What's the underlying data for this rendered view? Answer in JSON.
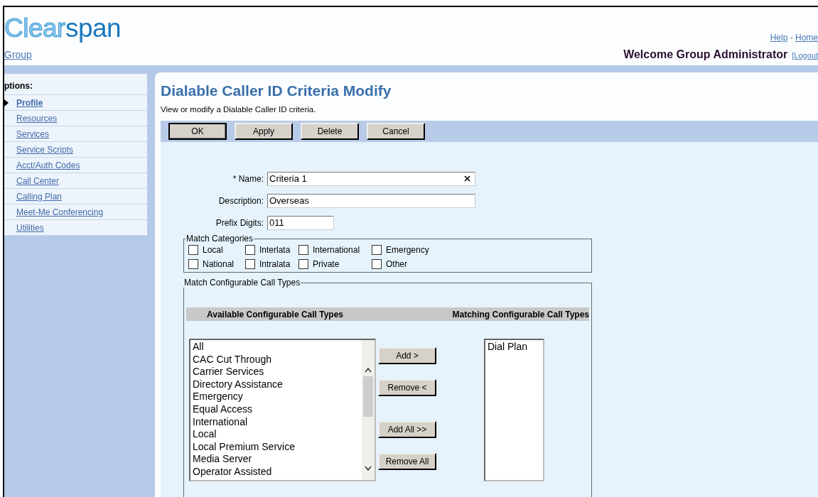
{
  "logo": {
    "part_1": "Clear",
    "part_2": "span"
  },
  "top_links": [
    {
      "label": "Help"
    },
    {
      "label": "Home"
    }
  ],
  "top_links_separator": "-",
  "breadcrumb": "Group",
  "welcome": "Welcome Group Administrator",
  "logout": "[Logout",
  "sidebar": {
    "heading": "ptions:",
    "items": [
      {
        "label": "Profile",
        "selected": true
      },
      {
        "label": "Resources",
        "selected": false
      },
      {
        "label": "Services",
        "selected": false
      },
      {
        "label": "Service Scripts",
        "selected": false
      },
      {
        "label": "Acct/Auth Codes",
        "selected": false
      },
      {
        "label": "Call Center",
        "selected": false
      },
      {
        "label": "Calling Plan",
        "selected": false
      },
      {
        "label": "Meet-Me Conferencing",
        "selected": false
      },
      {
        "label": "Utilities",
        "selected": false
      }
    ]
  },
  "page": {
    "title": "Dialable Caller ID Criteria Modify",
    "description": "View or modify a Dialable Caller ID criteria."
  },
  "buttons": [
    {
      "label": "OK",
      "default": true
    },
    {
      "label": "Apply",
      "default": false
    },
    {
      "label": "Delete",
      "default": false
    },
    {
      "label": "Cancel",
      "default": false
    }
  ],
  "fields": [
    {
      "label": "* Name:",
      "value": "Criteria 1",
      "clearable": true
    },
    {
      "label": "Description:",
      "value": "Overseas",
      "clearable": false
    },
    {
      "label": "Prefix Digits:",
      "value": "011",
      "clearable": false
    }
  ],
  "match_categories": {
    "legend": "Match Categories",
    "options": [
      {
        "label": "Local",
        "checked": false
      },
      {
        "label": "Interlata",
        "checked": false
      },
      {
        "label": "International",
        "checked": false
      },
      {
        "label": "Emergency",
        "checked": false
      },
      {
        "label": "National",
        "checked": false
      },
      {
        "label": "Intralata",
        "checked": false
      },
      {
        "label": "Private",
        "checked": false
      },
      {
        "label": "Other",
        "checked": false
      }
    ]
  },
  "call_types": {
    "legend": "Match Configurable Call Types",
    "available_heading": "Available Configurable Call Types",
    "matching_heading": "Matching Configurable Call Types",
    "available": [
      "All",
      "CAC Cut Through",
      "Carrier Services",
      "Directory Assistance",
      "Emergency",
      "Equal Access",
      "International",
      "Local",
      "Local Premium Service",
      "Media Server",
      "Operator Assisted"
    ],
    "matching": [
      "Dial Plan"
    ],
    "actions": [
      "Add >",
      "Remove <",
      "Add All >>",
      "Remove All"
    ]
  }
}
